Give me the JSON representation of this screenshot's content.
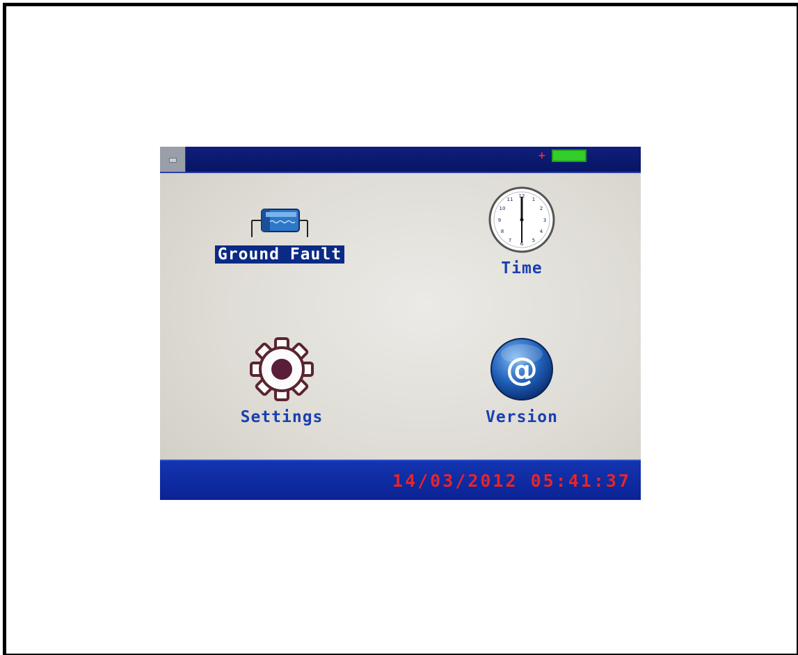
{
  "menu": {
    "items": [
      {
        "label": "Ground Fault",
        "icon": "capacitor-icon",
        "selected": true
      },
      {
        "label": "Time",
        "icon": "clock-icon",
        "selected": false
      },
      {
        "label": "Settings",
        "icon": "gear-icon",
        "selected": false
      },
      {
        "label": "Version",
        "icon": "at-sign-icon",
        "selected": false
      }
    ]
  },
  "status": {
    "indicator": "+",
    "battery_color": "#34ce2a"
  },
  "footer": {
    "datetime": "14/03/2012 05:41:37"
  },
  "colors": {
    "bar_blue": "#0a2394",
    "label_blue": "#1a3fb0",
    "selection": "#0b2a86",
    "datetime_red": "#e8242a"
  }
}
